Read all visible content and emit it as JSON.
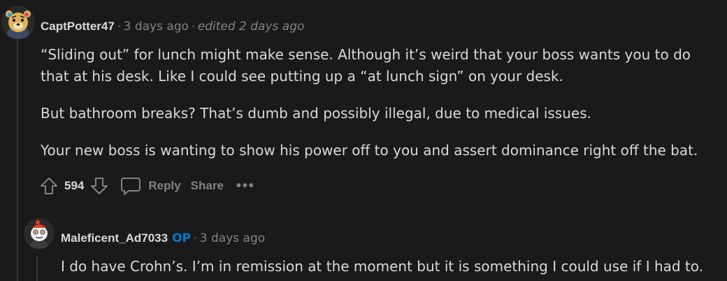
{
  "comments": [
    {
      "author": "CaptPotter47",
      "time": "3 days ago",
      "edited": "edited 2 days ago",
      "paragraphs": [
        "“Sliding out” for lunch might make sense. Although it’s weird that your boss wants you to do that at his desk. Like I could see putting up a “at lunch sign” on your desk.",
        "But bathroom breaks? That’s dumb and possibly illegal, due to medical issues.",
        "Your new boss is wanting to show his power off to you and assert dominance right off the bat."
      ],
      "score": "594",
      "reply_label": "Reply",
      "share_label": "Share",
      "more_label": "•••"
    },
    {
      "author": "Maleficent_Ad7033",
      "op_badge": "OP",
      "time": "3 days ago",
      "paragraphs": [
        "I do have Crohn’s. I’m in remission at the moment but it is something I could use if I had to."
      ]
    }
  ],
  "icons": {
    "upvote": "arrow-up-icon",
    "downvote": "arrow-down-icon",
    "reply": "speech-bubble-icon",
    "more": "ellipsis-icon"
  },
  "colors": {
    "background": "#1a1a1b",
    "text": "#d7dadc",
    "meta": "#818384",
    "op": "#0079d3",
    "thread_line": "#343536"
  }
}
